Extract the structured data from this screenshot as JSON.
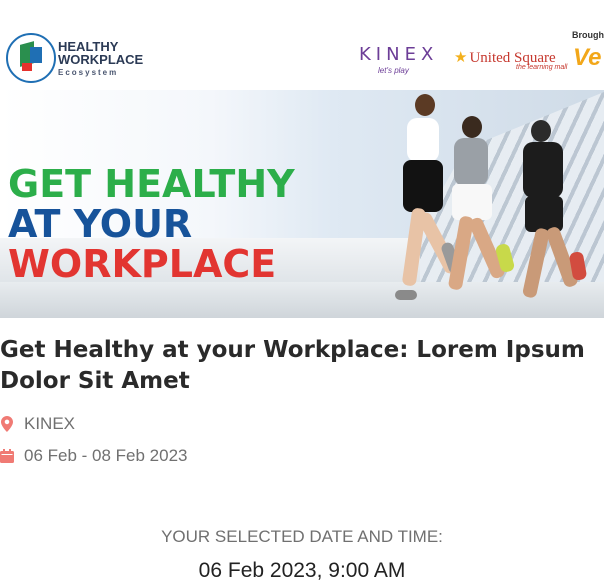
{
  "banner": {
    "logo_name_line1": "HEALTHY",
    "logo_name_line2": "WORKPLACE",
    "logo_name_line3": "Ecosystem",
    "sponsor_kinex": "KINEX",
    "sponsor_kinex_tagline": "let's play",
    "sponsor_united_square": "United Square",
    "sponsor_united_square_tagline": "the learning mall",
    "brought_by_label": "Brought",
    "headline_line1": "GET HEALTHY",
    "headline_line2": "AT YOUR",
    "headline_line3": "WORKPLACE",
    "colors": {
      "green": "#2cae4a",
      "blue": "#17539a",
      "red": "#e23531"
    }
  },
  "event": {
    "title": "Get Healthy at your Workplace: Lorem Ipsum Dolor Sit Amet",
    "location": "KINEX",
    "location_icon": "map-pin-icon",
    "date_range": "06 Feb - 08 Feb 2023",
    "date_icon": "calendar-icon",
    "accent_color": "#f07a74"
  },
  "selection": {
    "label": "YOUR SELECTED DATE AND TIME:",
    "value": "06 Feb 2023, 9:00 AM"
  }
}
